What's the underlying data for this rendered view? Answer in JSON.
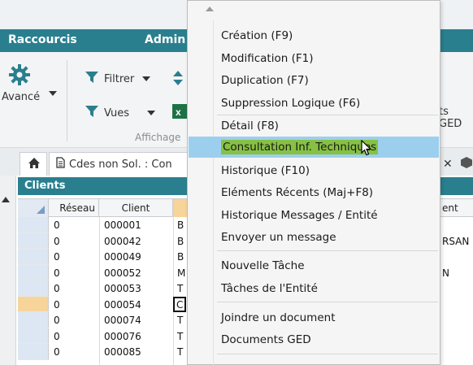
{
  "ribbon": {
    "tabs": [
      "Raccourcis",
      "Admin"
    ],
    "avance_label": "Avancé",
    "filtrer_label": "Filtrer",
    "vues_label": "Vues",
    "affichage_label": "Affichage",
    "ged_label": "ts GED"
  },
  "tabs": {
    "document_tab_label": "Cdes non Sol. : Con",
    "close_glyph": "✕"
  },
  "panel": {
    "title": "Clients",
    "columns": [
      "Réseau",
      "Client",
      "",
      "ent"
    ],
    "rows": [
      {
        "reseau": "0",
        "client": "000001",
        "name": "B",
        "extra": ""
      },
      {
        "reseau": "0",
        "client": "000042",
        "name": "B",
        "extra": "RSAN"
      },
      {
        "reseau": "0",
        "client": "000049",
        "name": "B",
        "extra": ""
      },
      {
        "reseau": "0",
        "client": "000052",
        "name": "M",
        "extra": "N"
      },
      {
        "reseau": "0",
        "client": "000053",
        "name": "T",
        "extra": ""
      },
      {
        "reseau": "0",
        "client": "000054",
        "name": "C",
        "extra": ""
      },
      {
        "reseau": "0",
        "client": "000074",
        "name": "T",
        "extra": ""
      },
      {
        "reseau": "0",
        "client": "000076",
        "name": "T",
        "extra": ""
      },
      {
        "reseau": "0",
        "client": "000085",
        "name": "T",
        "extra": ""
      }
    ]
  },
  "menu": {
    "items": [
      "Création (F9)",
      "Modification (F1)",
      "Duplication (F7)",
      "Suppression Logique (F6)",
      "Détail (F8)",
      "Consultation Inf. Techniques",
      "Historique (F10)",
      "Eléments Récents (Maj+F8)",
      "Historique Messages / Entité",
      "Envoyer un message",
      "Nouvelle Tâche",
      "Tâches de l'Entité",
      "Joindre un document",
      "Documents GED"
    ]
  },
  "colors": {
    "accent": "#2a7f8f",
    "menu_highlight": "#9ccfee",
    "text_highlight": "#86c144",
    "selected_row": "#f6d49a"
  }
}
